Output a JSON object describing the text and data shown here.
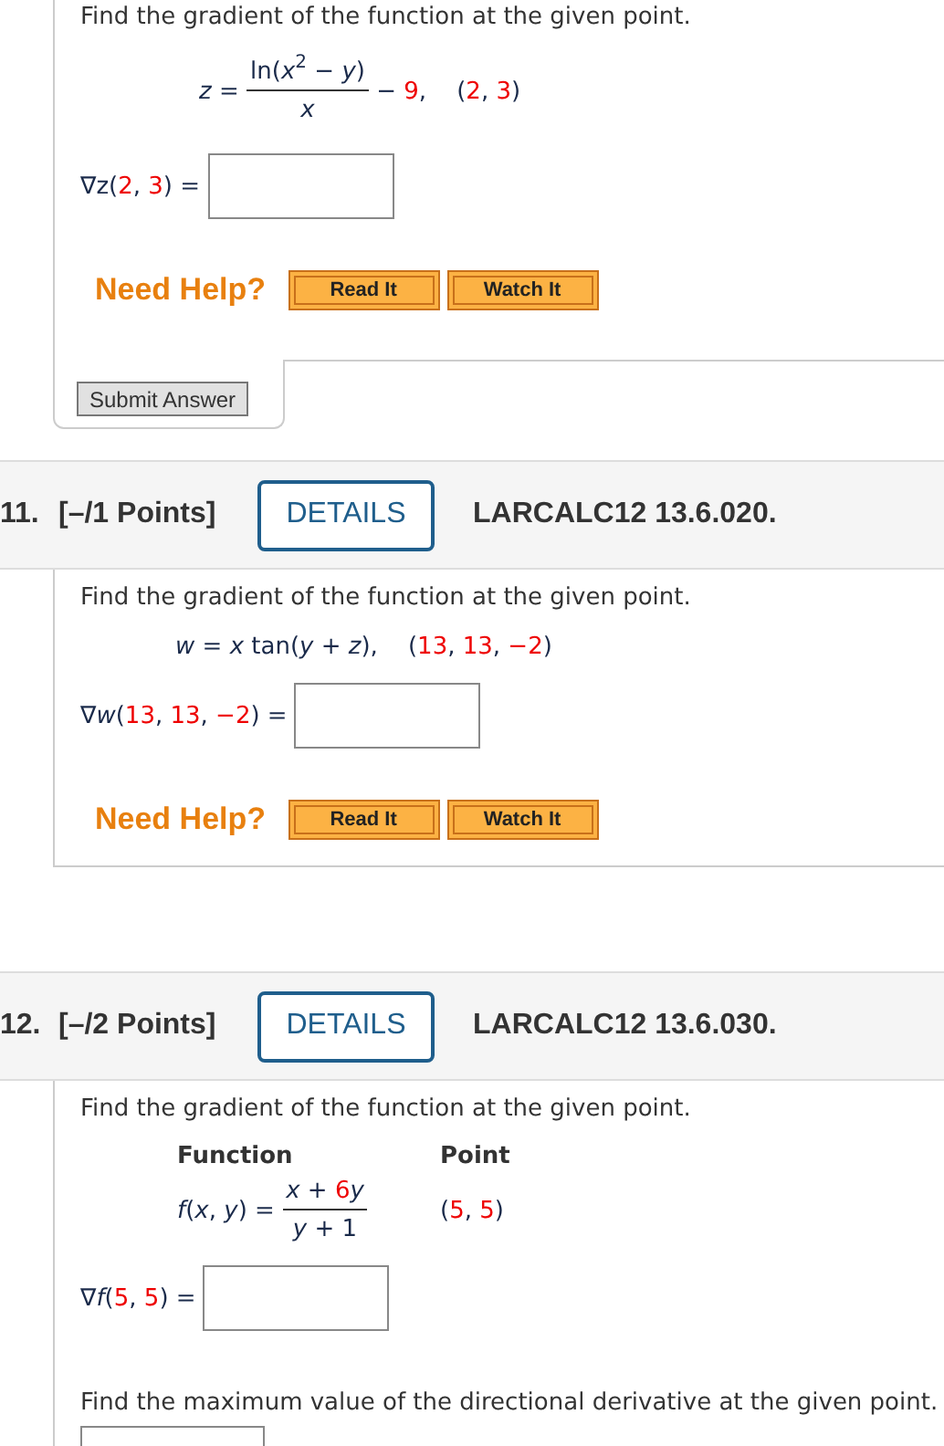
{
  "top_question": {
    "prompt": "Find the gradient of the function at the given point.",
    "formula": [
      {
        "kind": "var",
        "text": "z"
      },
      {
        "kind": "text",
        "text": " = "
      },
      {
        "kind": "frac",
        "num": [
          {
            "kind": "text",
            "text": "ln("
          },
          {
            "kind": "var",
            "text": "x"
          },
          {
            "kind": "sup",
            "text": "2"
          },
          {
            "kind": "text",
            "text": " − "
          },
          {
            "kind": "var",
            "text": "y"
          },
          {
            "kind": "text",
            "text": ")"
          }
        ],
        "den": [
          {
            "kind": "var",
            "text": "x"
          }
        ]
      },
      {
        "kind": "text",
        "text": " − "
      },
      {
        "kind": "value",
        "text": "9"
      },
      {
        "kind": "text",
        "text": ",    ("
      },
      {
        "kind": "value",
        "text": "2"
      },
      {
        "kind": "text",
        "text": ", "
      },
      {
        "kind": "value",
        "text": "3"
      },
      {
        "kind": "text",
        "text": ")"
      }
    ],
    "answer_label": [
      {
        "kind": "text",
        "text": "∇z("
      },
      {
        "kind": "value",
        "text": "2"
      },
      {
        "kind": "text",
        "text": ", "
      },
      {
        "kind": "value",
        "text": "3"
      },
      {
        "kind": "text",
        "text": ") = "
      }
    ],
    "help": {
      "label": "Need Help?",
      "buttons": [
        "Read It",
        "Watch It"
      ]
    },
    "submit": "Submit Answer"
  },
  "questions": [
    {
      "number": "11.",
      "points": "[–/1 Points]",
      "details": "DETAILS",
      "code": "LARCALC12 13.6.020.",
      "prompt": "Find the gradient of the function at the given point.",
      "formula": [
        {
          "kind": "var",
          "text": "w"
        },
        {
          "kind": "text",
          "text": " = "
        },
        {
          "kind": "var",
          "text": "x"
        },
        {
          "kind": "text",
          "text": " tan("
        },
        {
          "kind": "var",
          "text": "y"
        },
        {
          "kind": "text",
          "text": " + "
        },
        {
          "kind": "var",
          "text": "z"
        },
        {
          "kind": "text",
          "text": "),    ("
        },
        {
          "kind": "value",
          "text": "13"
        },
        {
          "kind": "text",
          "text": ", "
        },
        {
          "kind": "value",
          "text": "13"
        },
        {
          "kind": "text",
          "text": ", "
        },
        {
          "kind": "value",
          "text": "−2"
        },
        {
          "kind": "text",
          "text": ")"
        }
      ],
      "answer_label": [
        {
          "kind": "text",
          "text": "∇"
        },
        {
          "kind": "var",
          "text": "w"
        },
        {
          "kind": "text",
          "text": "("
        },
        {
          "kind": "value",
          "text": "13"
        },
        {
          "kind": "text",
          "text": ", "
        },
        {
          "kind": "value",
          "text": "13"
        },
        {
          "kind": "text",
          "text": ", "
        },
        {
          "kind": "value",
          "text": "−2"
        },
        {
          "kind": "text",
          "text": ") = "
        }
      ],
      "help": {
        "label": "Need Help?",
        "buttons": [
          "Read It",
          "Watch It"
        ]
      }
    },
    {
      "number": "12.",
      "points": "[–/2 Points]",
      "details": "DETAILS",
      "code": "LARCALC12 13.6.030.",
      "prompt": "Find the gradient of the function at the given point.",
      "function_table": {
        "headers": [
          "Function",
          "Point"
        ],
        "function": [
          {
            "kind": "var",
            "text": "f"
          },
          {
            "kind": "text",
            "text": "("
          },
          {
            "kind": "var",
            "text": "x"
          },
          {
            "kind": "text",
            "text": ", "
          },
          {
            "kind": "var",
            "text": "y"
          },
          {
            "kind": "text",
            "text": ") = "
          },
          {
            "kind": "frac",
            "num": [
              {
                "kind": "var",
                "text": "x"
              },
              {
                "kind": "text",
                "text": " + "
              },
              {
                "kind": "value",
                "text": "6"
              },
              {
                "kind": "var",
                "text": "y"
              }
            ],
            "den": [
              {
                "kind": "var",
                "text": "y"
              },
              {
                "kind": "text",
                "text": " + 1"
              }
            ]
          }
        ],
        "point": [
          {
            "kind": "text",
            "text": "("
          },
          {
            "kind": "value",
            "text": "5"
          },
          {
            "kind": "text",
            "text": ", "
          },
          {
            "kind": "value",
            "text": "5"
          },
          {
            "kind": "text",
            "text": ")"
          }
        ]
      },
      "answer_label": [
        {
          "kind": "text",
          "text": "∇"
        },
        {
          "kind": "var",
          "text": "f"
        },
        {
          "kind": "text",
          "text": "("
        },
        {
          "kind": "value",
          "text": "5"
        },
        {
          "kind": "text",
          "text": ", "
        },
        {
          "kind": "value",
          "text": "5"
        },
        {
          "kind": "text",
          "text": ") = "
        }
      ],
      "second_prompt": "Find the maximum value of the directional derivative at the given point."
    }
  ]
}
